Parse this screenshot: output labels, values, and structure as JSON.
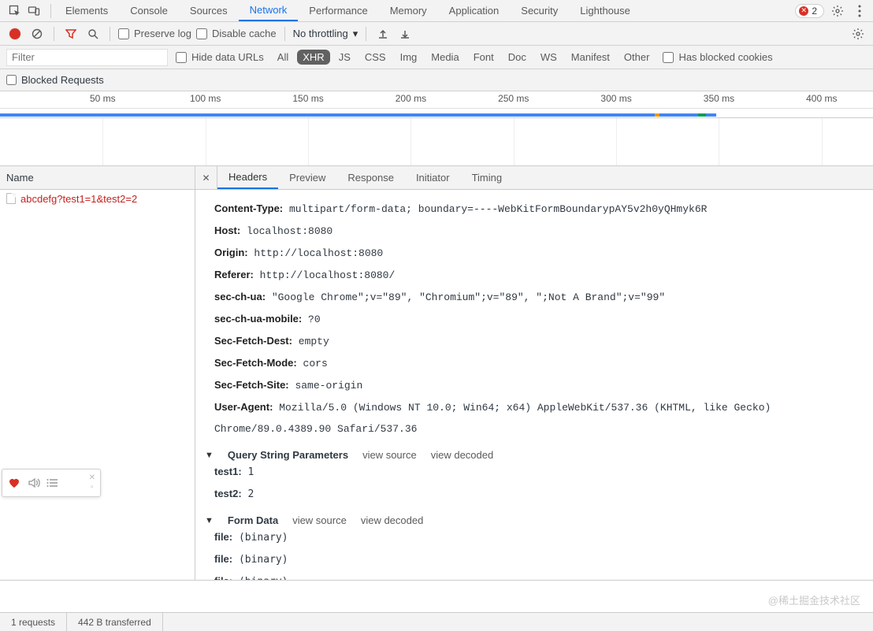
{
  "tabs": {
    "main": [
      "Elements",
      "Console",
      "Sources",
      "Network",
      "Performance",
      "Memory",
      "Application",
      "Security",
      "Lighthouse"
    ],
    "active": "Network",
    "error_count": "2"
  },
  "toolbar": {
    "preserve": "Preserve log",
    "disable_cache": "Disable cache",
    "throttle": "No throttling"
  },
  "filterbar": {
    "filter_placeholder": "Filter",
    "hide_urls": "Hide data URLs",
    "types": [
      "All",
      "XHR",
      "JS",
      "CSS",
      "Img",
      "Media",
      "Font",
      "Doc",
      "WS",
      "Manifest",
      "Other"
    ],
    "active_type": "XHR",
    "blocked_cookies": "Has blocked cookies"
  },
  "blocked_requests": "Blocked Requests",
  "timeline": {
    "ticks": [
      "50 ms",
      "100 ms",
      "150 ms",
      "200 ms",
      "250 ms",
      "300 ms",
      "350 ms",
      "400 ms"
    ]
  },
  "reqlist": {
    "header": "Name",
    "rows": [
      {
        "label": "abcdefg?test1=1&test2=2"
      }
    ]
  },
  "detail": {
    "tabs": [
      "Headers",
      "Preview",
      "Response",
      "Initiator",
      "Timing"
    ],
    "active": "Headers",
    "headers": [
      {
        "k": "Content-Type",
        "v": " multipart/form-data; boundary=----WebKitFormBoundarypAY5v2h0yQHmyk6R"
      },
      {
        "k": "Host",
        "v": " localhost:8080"
      },
      {
        "k": "Origin",
        "v": " http://localhost:8080"
      },
      {
        "k": "Referer",
        "v": " http://localhost:8080/"
      },
      {
        "k": "sec-ch-ua",
        "v": " \"Google Chrome\";v=\"89\", \"Chromium\";v=\"89\", \";Not A Brand\";v=\"99\""
      },
      {
        "k": "sec-ch-ua-mobile",
        "v": " ?0"
      },
      {
        "k": "Sec-Fetch-Dest",
        "v": " empty"
      },
      {
        "k": "Sec-Fetch-Mode",
        "v": " cors"
      },
      {
        "k": "Sec-Fetch-Site",
        "v": " same-origin"
      },
      {
        "k": "User-Agent",
        "v": " Mozilla/5.0 (Windows NT 10.0; Win64; x64) AppleWebKit/537.36 (KHTML, like Gecko) Chrome/89.0.4389.90 Safari/537.36"
      }
    ],
    "sections": {
      "qsp_title": "Query String Parameters",
      "view_source": "view source",
      "view_decoded": "view decoded",
      "qsp": [
        {
          "k": "test1",
          "v": " 1"
        },
        {
          "k": "test2",
          "v": " 2"
        }
      ],
      "form_title": "Form Data",
      "form": [
        {
          "k": "file",
          "v": " (binary)"
        },
        {
          "k": "file",
          "v": " (binary)"
        },
        {
          "k": "file",
          "v": " (binary)"
        }
      ]
    }
  },
  "status": {
    "requests": "1 requests",
    "transferred": "442 B transferred"
  },
  "watermark": "@稀土掘金技术社区"
}
